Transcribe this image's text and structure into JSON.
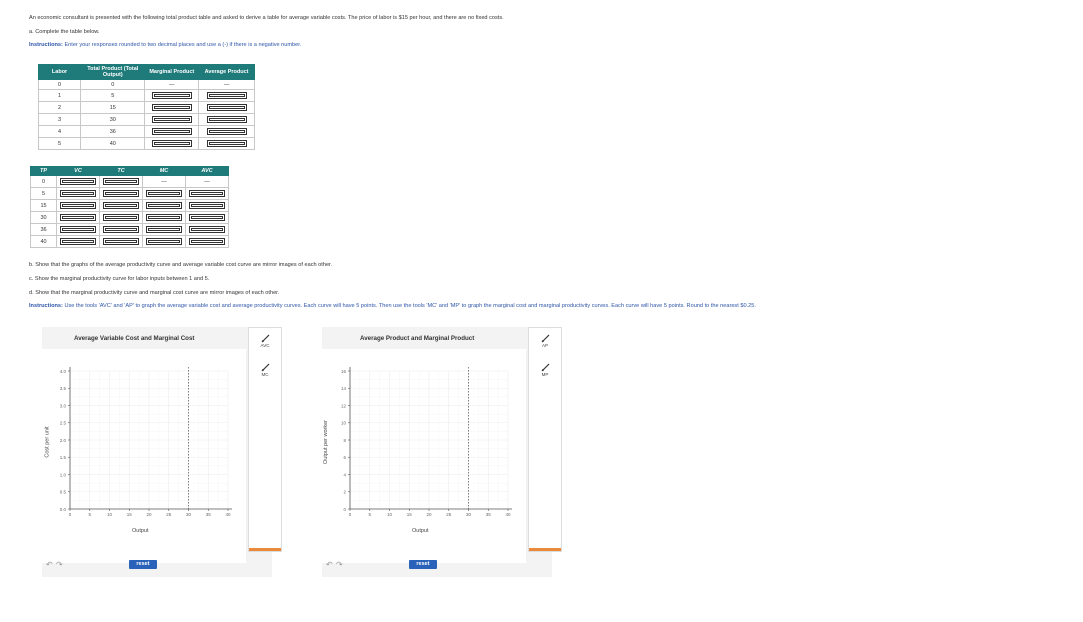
{
  "intro": "An economic consultant is presented with the following total product table and asked to derive a table for average variable costs. The price of labor is $15 per hour, and there are no fixed costs.",
  "part_a": "a. Complete the table below.",
  "instructions_a_label": "Instructions:",
  "instructions_a": "Enter your responses rounded to two decimal places and use a (-) if there is a negative number.",
  "table1": {
    "headers": [
      "Labor",
      "Total Product (Total Output)",
      "Marginal Product",
      "Average Product"
    ],
    "rows": [
      {
        "labor": "0",
        "tp": "0",
        "mp": "—",
        "ap": "—"
      },
      {
        "labor": "1",
        "tp": "5"
      },
      {
        "labor": "2",
        "tp": "15"
      },
      {
        "labor": "3",
        "tp": "30"
      },
      {
        "labor": "4",
        "tp": "36"
      },
      {
        "labor": "5",
        "tp": "40"
      }
    ]
  },
  "table2": {
    "headers": [
      "TP",
      "VC",
      "TC",
      "MC",
      "AVC"
    ],
    "rows": [
      {
        "tp": "0",
        "mc": "—",
        "avc": "—"
      },
      {
        "tp": "5"
      },
      {
        "tp": "15"
      },
      {
        "tp": "30"
      },
      {
        "tp": "36"
      },
      {
        "tp": "40"
      }
    ]
  },
  "part_b": "b. Show that the graphs of the average productivity curve and average variable cost curve are mirror images of each other.",
  "part_c": "c. Show the marginal productivity curve for labor inputs between 1 and 5.",
  "part_d": "d. Show that the marginal productivity curve and marginal cost curve are mirror images of each other.",
  "instructions_b_label": "Instructions:",
  "instructions_b": "Use the tools 'AVC' and 'AP' to graph the average variable cost and average productivity curves. Each curve will have 5 points. Then use the tools 'MC' and 'MP' to graph the marginal cost and marginal productivity curves. Each curve will have 5 points. Round to the nearest $0.25.",
  "graph1": {
    "title": "Average Variable Cost and Marginal Cost",
    "ylabel": "Cost per unit",
    "xlabel": "Output",
    "yticks": [
      "0.0",
      "0.5",
      "1.0",
      "1.5",
      "2.0",
      "2.5",
      "3.0",
      "3.5",
      "4.0"
    ],
    "xticks": [
      "0",
      "5",
      "10",
      "15",
      "20",
      "25",
      "30",
      "35",
      "40"
    ],
    "tools": [
      "AVC",
      "MC"
    ],
    "reset": "reset"
  },
  "graph2": {
    "title": "Average Product and Marginal Product",
    "ylabel": "Output per worker",
    "xlabel": "Output",
    "yticks": [
      "0",
      "2",
      "4",
      "6",
      "8",
      "10",
      "12",
      "14",
      "16"
    ],
    "xticks": [
      "0",
      "5",
      "10",
      "15",
      "20",
      "25",
      "30",
      "35",
      "40"
    ],
    "tools": [
      "AP",
      "MP"
    ],
    "reset": "reset"
  },
  "colors": {
    "header": "#1f7a7a",
    "instructions": "#2e56a8",
    "reset": "#2962b8",
    "accent": "#e8893b"
  }
}
